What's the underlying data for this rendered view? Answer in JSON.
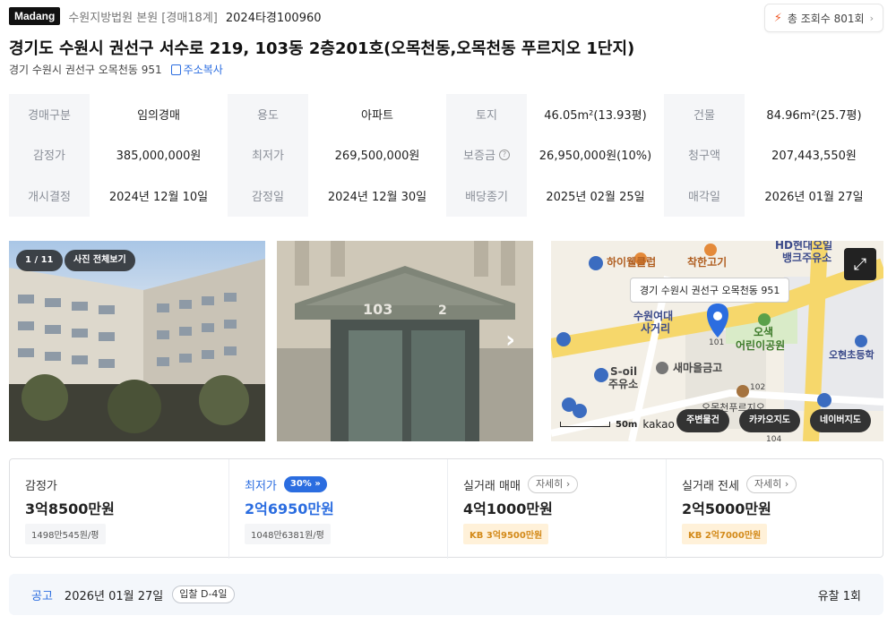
{
  "header": {
    "logo": "Madang",
    "court": "수원지방법원 본원",
    "court_sub": "[경매18계]",
    "case_no": "2024타경100960",
    "views": "총 조회수 801회"
  },
  "title": "경기도 수원시 권선구 서수로 219, 103동 2층201호(오목천동,오목천동 푸르지오 1단지)",
  "address": {
    "lot": "경기 수원시 권선구 오목천동 951",
    "copy_label": "주소복사"
  },
  "info": {
    "rows": [
      [
        {
          "label": "경매구분",
          "value": "임의경매"
        },
        {
          "label": "용도",
          "value": "아파트"
        },
        {
          "label": "토지",
          "value": "46.05m²(13.93평)"
        },
        {
          "label": "건물",
          "value": "84.96m²(25.7평)"
        }
      ],
      [
        {
          "label": "감정가",
          "value": "385,000,000원"
        },
        {
          "label": "최저가",
          "value": "269,500,000원"
        },
        {
          "label": "보증금",
          "value": "26,950,000원(10%)"
        },
        {
          "label": "청구액",
          "value": "207,443,550원"
        }
      ],
      [
        {
          "label": "개시결정",
          "value": "2024년 12월 10일"
        },
        {
          "label": "감정일",
          "value": "2024년 12월 30일"
        },
        {
          "label": "배당종기",
          "value": "2025년 02월 25일"
        },
        {
          "label": "매각일",
          "value": "2026년 01월 27일"
        }
      ]
    ],
    "deposit_help": "?"
  },
  "photos": {
    "count": "1 / 11",
    "view_all": "사진 전체보기",
    "next": "›"
  },
  "map": {
    "tooltip": "경기 수원시 권선구 오목천동 951",
    "expand_icon": "expand-icon",
    "scale": "50m",
    "brand": "kakao",
    "labels": {
      "hd_bank": "HD현대오일",
      "hd_bank_2": "뱅크주유소",
      "meat": "착한고기",
      "hiweluck": "하이웰클럽",
      "intersection_1": "수원여대",
      "intersection_2": "사거리",
      "park_1": "오색",
      "park_2": "어린이공원",
      "school": "오현초등학",
      "soil_1": "S-oil",
      "soil_2": "주유소",
      "bank": "새마을금고",
      "apt": "오목천푸르지오",
      "b101": "101",
      "b102": "102",
      "b104": "104"
    },
    "btn_nearby": "주변물건",
    "btn_kakao": "카카오지도",
    "btn_naver": "네이버지도"
  },
  "summary": {
    "appraisal": {
      "label": "감정가",
      "amount": "3억8500만원",
      "sub": "1498만545원/평"
    },
    "minimum": {
      "label": "최저가",
      "pct": "30%",
      "amount": "2억6950만원",
      "sub": "1048만6381원/평"
    },
    "sale": {
      "label": "실거래 매매",
      "detail": "자세히",
      "amount": "4억1000만원",
      "sub": "KB 3억9500만원"
    },
    "lease": {
      "label": "실거래 전세",
      "detail": "자세히",
      "amount": "2억5000만원",
      "sub": "KB 2억7000만원"
    }
  },
  "notice": {
    "label": "공고",
    "date": "2026년 01월 27일",
    "dday": "입찰 D-4일",
    "result": "유찰 1회"
  },
  "colors": {
    "accent": "#2b6de0",
    "bolt": "#f05a28",
    "kb_bg": "#fff1d9",
    "kb_text": "#d38a1a"
  }
}
